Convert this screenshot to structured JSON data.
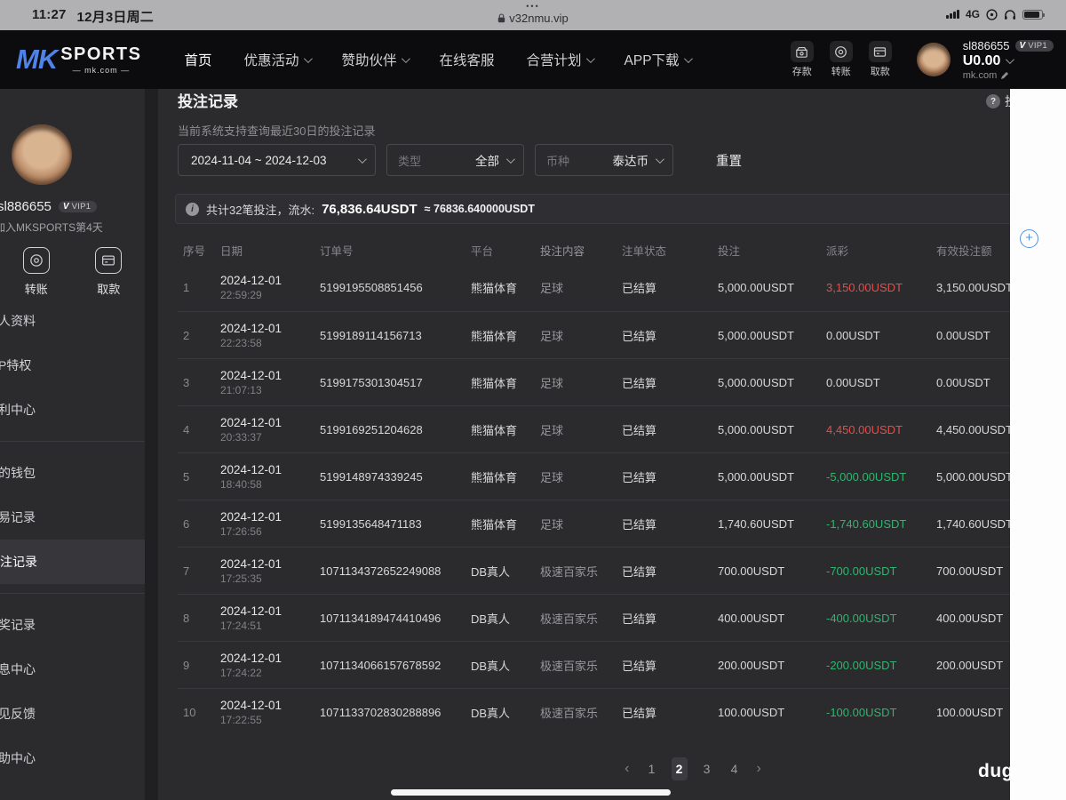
{
  "status_bar": {
    "time": "11:27",
    "date": "12月3日周二",
    "menu_dots": "•••",
    "url": "v32nmu.vip",
    "network": "4G"
  },
  "header": {
    "logo_mk": "MK",
    "logo_sports": "SPORTS",
    "logo_domain": "— mk.com —",
    "nav": [
      {
        "label": "首页",
        "dropdown": false,
        "active": true
      },
      {
        "label": "优惠活动",
        "dropdown": true,
        "active": false
      },
      {
        "label": "赞助伙伴",
        "dropdown": true,
        "active": false
      },
      {
        "label": "在线客服",
        "dropdown": false,
        "active": false
      },
      {
        "label": "合营计划",
        "dropdown": true,
        "active": false
      },
      {
        "label": "APP下载",
        "dropdown": true,
        "active": false
      }
    ],
    "actions": [
      {
        "label": "存款",
        "icon": "deposit-icon"
      },
      {
        "label": "转账",
        "icon": "transfer-icon"
      },
      {
        "label": "取款",
        "icon": "withdraw-icon"
      }
    ],
    "user": {
      "name": "sl886655",
      "vip_v": "V",
      "vip": "VIP1",
      "balance": "U0.00",
      "site": "mk.com"
    }
  },
  "sidebar": {
    "username": "sl886655",
    "vip_v": "V",
    "vip": "VIP1",
    "join_text": "加入MKSPORTS第4天",
    "quick_actions": [
      {
        "label": "转账",
        "icon": "transfer-icon"
      },
      {
        "label": "取款",
        "icon": "withdraw-icon"
      }
    ],
    "menu": [
      {
        "label": "人资料",
        "active": false,
        "divider_after": false
      },
      {
        "label": "P特权",
        "active": false,
        "divider_after": false
      },
      {
        "label": "利中心",
        "active": false,
        "divider_after": true
      },
      {
        "label": "的钱包",
        "active": false,
        "divider_after": false
      },
      {
        "label": "易记录",
        "active": false,
        "divider_after": false
      },
      {
        "label": "注记录",
        "active": true,
        "divider_after": true
      },
      {
        "label": "奖记录",
        "active": false,
        "divider_after": false
      },
      {
        "label": "息中心",
        "active": false,
        "divider_after": false
      },
      {
        "label": "见反馈",
        "active": false,
        "divider_after": false
      },
      {
        "label": "助中心",
        "active": false,
        "divider_after": false
      }
    ]
  },
  "main": {
    "title": "投注记录",
    "help_glyph": "?",
    "help_cut_text": "投",
    "subtitle": "当前系统支持查询最近30日的投注记录",
    "filters": {
      "date_range": "2024-11-04 ~ 2024-12-03",
      "type_label": "类型",
      "type_value": "全部",
      "currency_label": "币种",
      "currency_value": "泰达币",
      "reset_label": "重置"
    },
    "summary": {
      "info_glyph": "i",
      "text": "共计32笔投注，流水:",
      "amount": "76,836.64USDT",
      "approx": "≈ 76836.640000USDT"
    },
    "table": {
      "headers": [
        "序号",
        "日期",
        "订单号",
        "平台",
        "投注内容",
        "注单状态",
        "投注",
        "派彩",
        "有效投注额"
      ],
      "rows": [
        {
          "idx": "1",
          "date": "2024-12-01",
          "time": "22:59:29",
          "order": "5199195508851456",
          "platform": "熊猫体育",
          "content": "足球",
          "status": "已结算",
          "bet": "5,000.00USDT",
          "payout": "3,150.00USDT",
          "payout_color": "red",
          "valid": "3,150.00USDT"
        },
        {
          "idx": "2",
          "date": "2024-12-01",
          "time": "22:23:58",
          "order": "5199189114156713",
          "platform": "熊猫体育",
          "content": "足球",
          "status": "已结算",
          "bet": "5,000.00USDT",
          "payout": "0.00USDT",
          "payout_color": "plain",
          "valid": "0.00USDT"
        },
        {
          "idx": "3",
          "date": "2024-12-01",
          "time": "21:07:13",
          "order": "5199175301304517",
          "platform": "熊猫体育",
          "content": "足球",
          "status": "已结算",
          "bet": "5,000.00USDT",
          "payout": "0.00USDT",
          "payout_color": "plain",
          "valid": "0.00USDT"
        },
        {
          "idx": "4",
          "date": "2024-12-01",
          "time": "20:33:37",
          "order": "5199169251204628",
          "platform": "熊猫体育",
          "content": "足球",
          "status": "已结算",
          "bet": "5,000.00USDT",
          "payout": "4,450.00USDT",
          "payout_color": "red",
          "valid": "4,450.00USDT"
        },
        {
          "idx": "5",
          "date": "2024-12-01",
          "time": "18:40:58",
          "order": "5199148974339245",
          "platform": "熊猫体育",
          "content": "足球",
          "status": "已结算",
          "bet": "5,000.00USDT",
          "payout": "-5,000.00USDT",
          "payout_color": "green",
          "valid": "5,000.00USDT"
        },
        {
          "idx": "6",
          "date": "2024-12-01",
          "time": "17:26:56",
          "order": "5199135648471183",
          "platform": "熊猫体育",
          "content": "足球",
          "status": "已结算",
          "bet": "1,740.60USDT",
          "payout": "-1,740.60USDT",
          "payout_color": "green",
          "valid": "1,740.60USDT"
        },
        {
          "idx": "7",
          "date": "2024-12-01",
          "time": "17:25:35",
          "order": "1071134372652249088",
          "platform": "DB真人",
          "content": "极速百家乐",
          "status": "已结算",
          "bet": "700.00USDT",
          "payout": "-700.00USDT",
          "payout_color": "green",
          "valid": "700.00USDT"
        },
        {
          "idx": "8",
          "date": "2024-12-01",
          "time": "17:24:51",
          "order": "1071134189474410496",
          "platform": "DB真人",
          "content": "极速百家乐",
          "status": "已结算",
          "bet": "400.00USDT",
          "payout": "-400.00USDT",
          "payout_color": "green",
          "valid": "400.00USDT"
        },
        {
          "idx": "9",
          "date": "2024-12-01",
          "time": "17:24:22",
          "order": "1071134066157678592",
          "platform": "DB真人",
          "content": "极速百家乐",
          "status": "已结算",
          "bet": "200.00USDT",
          "payout": "-200.00USDT",
          "payout_color": "green",
          "valid": "200.00USDT"
        },
        {
          "idx": "10",
          "date": "2024-12-01",
          "time": "17:22:55",
          "order": "1071133702830288896",
          "platform": "DB真人",
          "content": "极速百家乐",
          "status": "已结算",
          "bet": "100.00USDT",
          "payout": "-100.00USDT",
          "payout_color": "green",
          "valid": "100.00USDT"
        }
      ]
    },
    "pagination": {
      "prev": "‹",
      "next": "›",
      "pages": [
        "1",
        "2",
        "3",
        "4"
      ],
      "active": "2"
    }
  },
  "misc": {
    "watermark": "dug",
    "fab_glyph": "+"
  },
  "colors": {
    "payout_red": "#df4f4e",
    "payout_green": "#2fb56e",
    "accent_blue": "#5494dd",
    "header_bg": "#0c0c0e",
    "panel_bg": "#2b2b2e"
  }
}
